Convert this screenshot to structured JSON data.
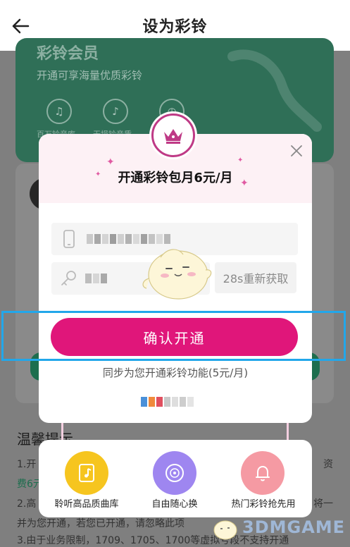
{
  "header": {
    "title": "设为彩铃"
  },
  "background": {
    "card_title": "彩铃会员",
    "card_subtitle": "开通可享海量优质彩铃",
    "card_labels": [
      "百万铃音库",
      "无损铃音质"
    ],
    "tips_title": "温馨提示",
    "tip_lines": [
      "1.开",
      "费6元",
      "2.高",
      "并为您开通，若您已开通，请忽略此项",
      "3.由于业务限制，1709、1705、1700等虚拟号段不支持开通"
    ],
    "tip_right": [
      "资",
      "将一"
    ]
  },
  "popup": {
    "title": "开通彩铃包月6元/月",
    "resend_label": "28s重新获取",
    "confirm_label": "确认开通",
    "sync_text": "同步为您开通彩铃功能(5元/月)"
  },
  "features": [
    {
      "label": "聆听高品质曲库",
      "icon": "music-file-icon",
      "color": "#f6c51f"
    },
    {
      "label": "自由随心换",
      "icon": "vinyl-disc-icon",
      "color": "#9e86f0"
    },
    {
      "label": "热门彩铃抢先用",
      "icon": "bell-icon",
      "color": "#f59aa3"
    }
  ],
  "colors": {
    "accent": "#e0167a",
    "highlight": "#22a7ea",
    "card_green": "#2f6f57"
  },
  "watermark": "3DMGAME"
}
